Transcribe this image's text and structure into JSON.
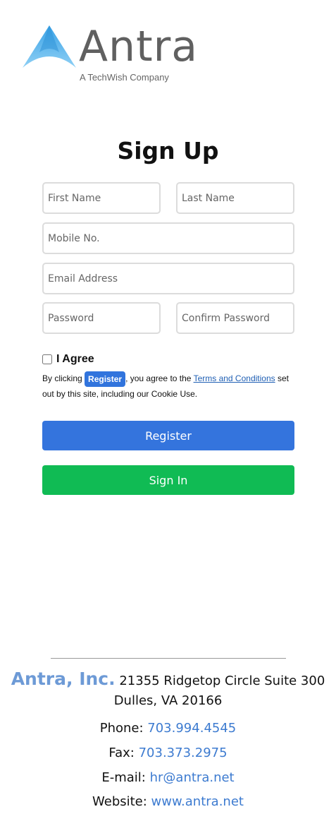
{
  "logo": {
    "wordmark": "Antra",
    "tagline": "A TechWish Company",
    "brand_color": "#3a9ee0"
  },
  "page_title": "Sign Up",
  "form": {
    "first_name_placeholder": "First Name",
    "last_name_placeholder": "Last Name",
    "mobile_placeholder": "Mobile No.",
    "email_placeholder": "Email Address",
    "password_placeholder": "Password",
    "confirm_password_placeholder": "Confirm Password",
    "agree_label": "I Agree",
    "terms_prefix": "By clicking ",
    "terms_badge": "Register",
    "terms_mid": ", you agree to the ",
    "terms_link": "Terms and Conditions",
    "terms_suffix": " set out by this site, including our Cookie Use.",
    "register_label": "Register",
    "signin_label": "Sign In"
  },
  "footer": {
    "company_name": "Antra, Inc.",
    "address_line1": " 21355 Ridgetop Circle Suite 300",
    "address_line2": "Dulles, VA 20166",
    "phone_label": "Phone: ",
    "phone_value": "703.994.4545",
    "fax_label": "Fax: ",
    "fax_value": "703.373.2975",
    "email_label": "E-mail: ",
    "email_value": "hr@antra.net",
    "website_label": "Website: ",
    "website_value": "www.antra.net"
  },
  "colors": {
    "register_button": "#3474dd",
    "signin_button": "#10bb54",
    "link_blue": "#3d7bd0"
  }
}
